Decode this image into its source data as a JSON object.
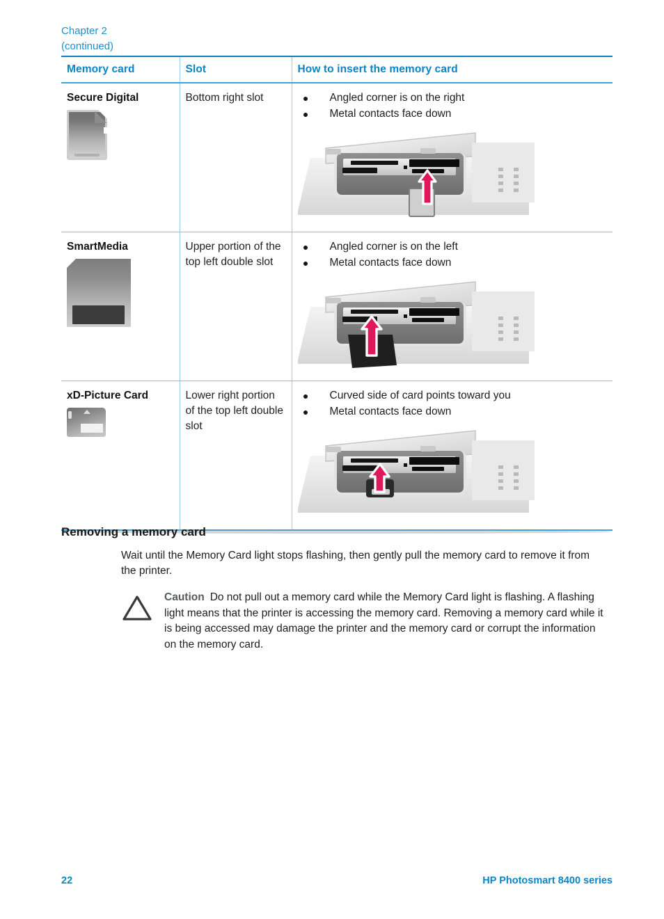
{
  "running_head": {
    "chapter": "Chapter 2",
    "continued": "(continued)"
  },
  "table": {
    "headers": {
      "memory_card": "Memory card",
      "slot": "Slot",
      "how_to_insert": "How to insert the memory card"
    },
    "rows": [
      {
        "card_name": "Secure Digital",
        "card_icon": "secure-digital-card-icon",
        "slot": "Bottom right slot",
        "bullets": [
          "Angled corner is on the right",
          "Metal contacts face down"
        ],
        "illustration": "printer-card-slot-bottom-right-illustration"
      },
      {
        "card_name": "SmartMedia",
        "card_icon": "smartmedia-card-icon",
        "slot": "Upper portion of the top left double slot",
        "bullets": [
          "Angled corner is on the left",
          "Metal contacts face down"
        ],
        "illustration": "printer-card-slot-top-left-upper-illustration"
      },
      {
        "card_name": "xD-Picture Card",
        "card_icon": "xd-picture-card-icon",
        "slot": "Lower right portion of the top left double slot",
        "bullets": [
          "Curved side of card points toward you",
          "Metal contacts face down"
        ],
        "illustration": "printer-card-slot-top-left-lower-illustration"
      }
    ]
  },
  "removing_section": {
    "title": "Removing a memory card",
    "paragraph": "Wait until the Memory Card light stops flashing, then gently pull the memory card to remove it from the printer.",
    "caution_label": "Caution",
    "caution_text": "Do not pull out a memory card while the Memory Card light is flashing. A flashing light means that the printer is accessing the memory card. Removing a memory card while it is being accessed may damage the printer and the memory card or corrupt the information on the memory card."
  },
  "footer": {
    "page_number": "22",
    "product": "HP Photosmart 8400 series"
  },
  "colors": {
    "accent_blue": "#0a85c6",
    "rule_blue": "#7cc4e8",
    "arrow_pink": "#e0175a",
    "caution_gray": "#555a5e"
  }
}
